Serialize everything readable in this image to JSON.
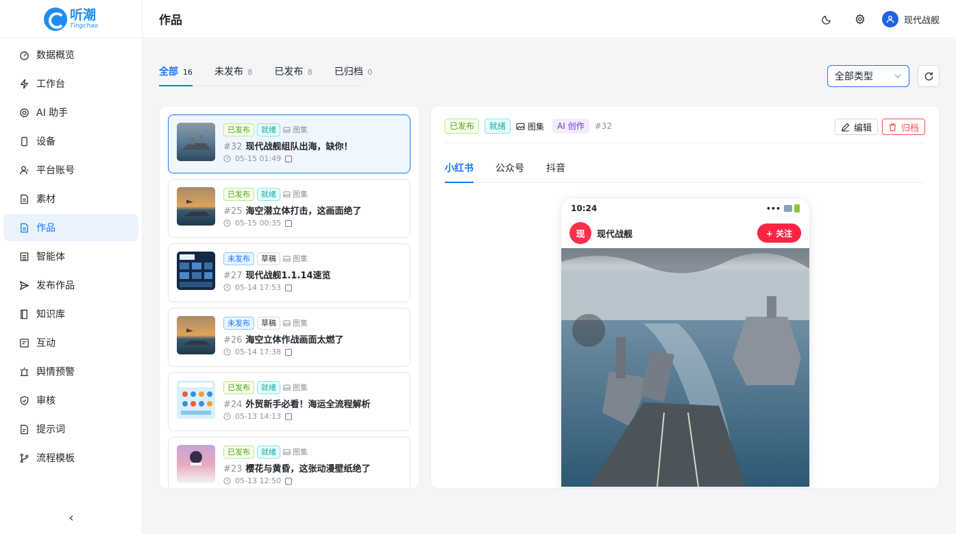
{
  "app": {
    "logo_cn": "听潮",
    "logo_en": "Tingchao",
    "page_title": "作品",
    "user_name": "现代战舰"
  },
  "sidebar": {
    "items": [
      {
        "label": "数据概览",
        "icon": "dashboard-icon"
      },
      {
        "label": "工作台",
        "icon": "lightning-icon"
      },
      {
        "label": "AI 助手",
        "icon": "ai-icon"
      },
      {
        "label": "设备",
        "icon": "phone-icon"
      },
      {
        "label": "平台账号",
        "icon": "account-icon"
      },
      {
        "label": "素材",
        "icon": "file-icon"
      },
      {
        "label": "作品",
        "icon": "document-icon",
        "active": true
      },
      {
        "label": "智能体",
        "icon": "agent-icon"
      },
      {
        "label": "发布作品",
        "icon": "send-icon"
      },
      {
        "label": "知识库",
        "icon": "book-icon"
      },
      {
        "label": "互动",
        "icon": "interaction-icon"
      },
      {
        "label": "舆情预警",
        "icon": "alarm-icon"
      },
      {
        "label": "审核",
        "icon": "shield-check-icon"
      },
      {
        "label": "提示词",
        "icon": "prompt-icon"
      },
      {
        "label": "流程模板",
        "icon": "branch-icon"
      }
    ],
    "collapse": "‹"
  },
  "tabs": [
    {
      "label": "全部",
      "count": "16",
      "active": true
    },
    {
      "label": "未发布",
      "count": "8"
    },
    {
      "label": "已发布",
      "count": "8"
    },
    {
      "label": "已归档",
      "count": "0"
    }
  ],
  "filter": {
    "type_value": "全部类型"
  },
  "works": [
    {
      "status": "已发布",
      "status_kind": "pub",
      "stage": "就绪",
      "stage_kind": "ready",
      "kind": "图集",
      "num": "#32",
      "title": "现代战舰组队出海，缺你！",
      "time": "05-15 01:49",
      "selected": true
    },
    {
      "status": "已发布",
      "status_kind": "pub",
      "stage": "就绪",
      "stage_kind": "ready",
      "kind": "图集",
      "num": "#25",
      "title": "海空潜立体打击，这画面绝了",
      "time": "05-15 00:35"
    },
    {
      "status": "未发布",
      "status_kind": "unpub",
      "stage": "草稿",
      "stage_kind": "draft",
      "kind": "图集",
      "num": "#27",
      "title": "现代战舰1.1.14速览",
      "time": "05-14 17:53"
    },
    {
      "status": "未发布",
      "status_kind": "unpub",
      "stage": "草稿",
      "stage_kind": "draft",
      "kind": "图集",
      "num": "#26",
      "title": "海空立体作战画面太燃了",
      "time": "05-14 17:38"
    },
    {
      "status": "已发布",
      "status_kind": "pub",
      "stage": "就绪",
      "stage_kind": "ready",
      "kind": "图集",
      "num": "#24",
      "title": "外贸新手必看！海运全流程解析",
      "time": "05-13 14:13"
    },
    {
      "status": "已发布",
      "status_kind": "pub",
      "stage": "就绪",
      "stage_kind": "ready",
      "kind": "图集",
      "num": "#23",
      "title": "樱花与黄昏，这张动漫壁纸绝了",
      "time": "05-13 12:50"
    }
  ],
  "detail": {
    "status": "已发布",
    "stage": "就绪",
    "kind": "图集",
    "ai_tag": "AI 创作",
    "num": "#32",
    "edit_label": "编辑",
    "archive_label": "归档",
    "platform_tabs": [
      "小红书",
      "公众号",
      "抖音"
    ],
    "preview": {
      "time": "10:24",
      "dots": "•••",
      "avatar_char": "现",
      "author": "现代战舰",
      "follow_label": "+ 关注"
    }
  },
  "colors": {
    "accent": "#1677ff",
    "published": "#52a41a",
    "ready": "#13a8a8",
    "danger": "#ff4d4f",
    "xhs_red": "#ff2442"
  }
}
